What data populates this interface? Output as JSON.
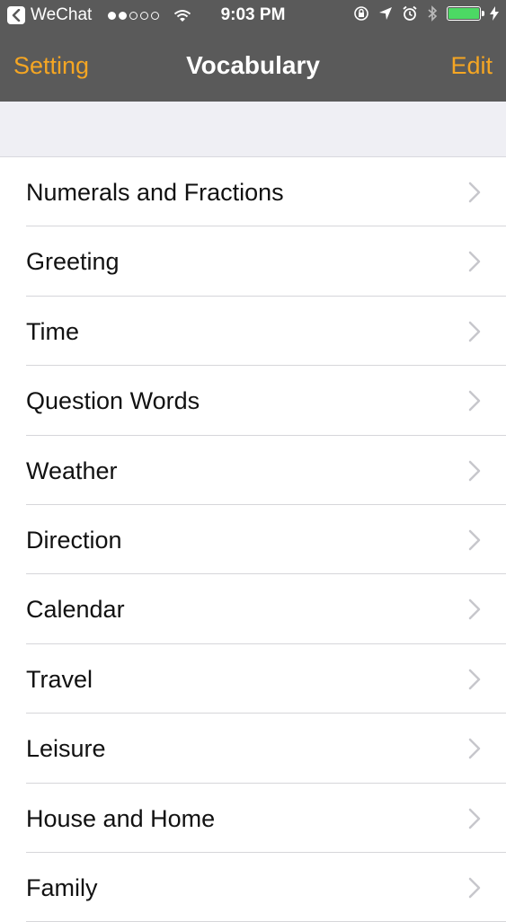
{
  "status_bar": {
    "carrier": "WeChat",
    "time": "9:03 PM",
    "signal_bars_filled": 2,
    "signal_bars_total": 5,
    "battery_level": 1.0,
    "icons": [
      "back-icon",
      "wifi-icon",
      "orientation-lock-icon",
      "location-icon",
      "alarm-icon",
      "bluetooth-icon",
      "battery-icon",
      "charging-icon"
    ]
  },
  "nav": {
    "left_label": "Setting",
    "title": "Vocabulary",
    "right_label": "Edit"
  },
  "colors": {
    "accent": "#f5a623",
    "bar": "#5a5a5a",
    "battery": "#4cd964"
  },
  "list": {
    "items": [
      {
        "label": "Numerals and Fractions"
      },
      {
        "label": "Greeting"
      },
      {
        "label": "Time"
      },
      {
        "label": "Question Words"
      },
      {
        "label": "Weather"
      },
      {
        "label": "Direction"
      },
      {
        "label": "Calendar"
      },
      {
        "label": "Travel"
      },
      {
        "label": "Leisure"
      },
      {
        "label": "House and Home"
      },
      {
        "label": "Family"
      }
    ]
  }
}
